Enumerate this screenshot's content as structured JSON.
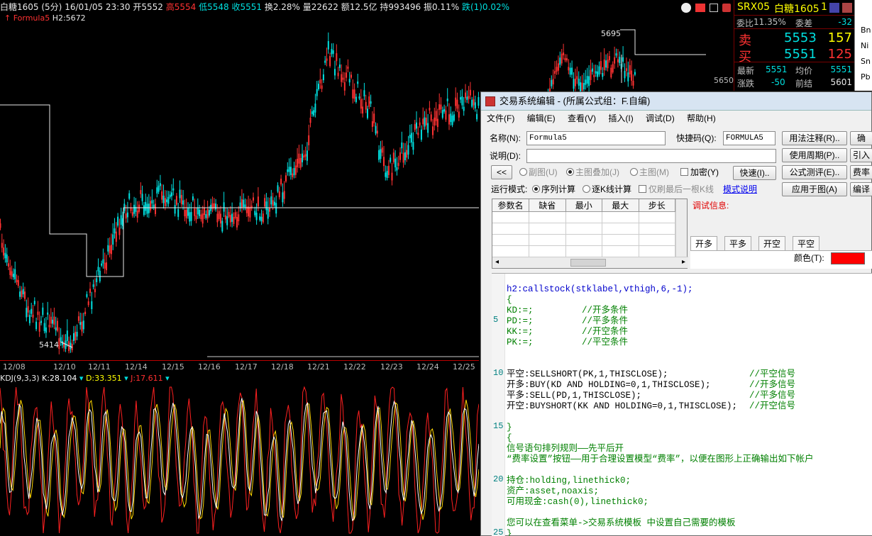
{
  "chart_header": {
    "symbol": "白糖1605 (5分)",
    "date_time": "16/01/05 23:30",
    "open": "开5552",
    "high": "高5554",
    "low": "低5548",
    "close": "收5551",
    "turnover": "换2.28%",
    "volume": "量22622",
    "amount": "额12.5亿",
    "position": "持993496",
    "amplitude": "振0.11%",
    "change": "跌(1)0.02%",
    "formula_name": "Formula5",
    "formula_value": "H2:5672"
  },
  "price_labels": {
    "high_mark": "5695",
    "low_mark": "5414",
    "scale": "5650"
  },
  "x_axis": [
    "12/08",
    "12/10",
    "12/11",
    "12/14",
    "12/15",
    "12/16",
    "12/17",
    "12/18",
    "12/21",
    "12/22",
    "12/23",
    "12/24",
    "12/25"
  ],
  "kdj_header": {
    "name": "KDJ(9,3,3)",
    "k": "K:28.104",
    "d": "D:33.351",
    "j": "J:17.611"
  },
  "quote": {
    "code": "SRX05",
    "name": "白糖1605",
    "count": "1",
    "weibi_label": "委比",
    "weibi_value": "11.35%",
    "weicha_label": "委差",
    "weicha_value": "-32",
    "sell_label": "卖",
    "sell_price": "5553",
    "sell_volume": "157",
    "buy_label": "买",
    "buy_price": "5551",
    "buy_volume": "125",
    "latest_label": "最新",
    "latest_value": "5551",
    "avg_label": "均价",
    "avg_value": "5551",
    "chg_label": "涨跌",
    "chg_value": "-50",
    "prev_label": "前结",
    "prev_value": "5601"
  },
  "side_strip": [
    "Bn",
    "Ni",
    "Sn",
    "Pb"
  ],
  "dialog": {
    "title": "交易系统编辑 - (所属公式组：F.自编)",
    "menu": [
      "文件(F)",
      "编辑(E)",
      "查看(V)",
      "插入(I)",
      "调试(D)",
      "帮助(H)"
    ],
    "name_label": "名称(N):",
    "name_value": "Formula5",
    "shortcut_label": "快捷码(Q):",
    "shortcut_value": "FORMULA5",
    "desc_label": "说明(D):",
    "desc_value": "",
    "collapse_btn": "<<",
    "radio_fushu": "副图(U)",
    "radio_zhutu_diejia": "主图叠加(J)",
    "radio_zhutu": "主图(M)",
    "check_encrypt": "加密(Y)",
    "btn_fast": "快速(I)..",
    "run_mode_label": "运行模式:",
    "run_mode_seq": "序列计算",
    "run_mode_kline": "逐K线计算",
    "check_refresh_last": "仅刷最后一根K线",
    "mode_help": "模式说明",
    "right_buttons": [
      "用法注释(R)..",
      "使用周期(P)..",
      "公式测评(E)..",
      "应用于图(A)"
    ],
    "far_buttons": [
      "确",
      "引入",
      "费率",
      "编译"
    ],
    "param_headers": [
      "参数名",
      "缺省",
      "最小",
      "最大",
      "步长"
    ],
    "debug_label": "调试信息:",
    "signal_tabs": [
      "开多",
      "平多",
      "开空",
      "平空"
    ],
    "color_label": "颜色(T):",
    "color_value": "#ff0000",
    "line_numbers": [
      "5",
      "10",
      "15",
      "20",
      "25"
    ],
    "code": {
      "l1": "h2:callstock(stklabel,vthigh,6,-1);",
      "l2": "{",
      "l3a": "KD:=;",
      "l3b": "//开多条件",
      "l4a": "PD:=;",
      "l4b": "//平多条件",
      "l5a": "KK:=;",
      "l5b": "//开空条件",
      "l6a": "PK:=;",
      "l6b": "//平空条件",
      "l7a": "平空:SELLSHORT(PK,1,THISCLOSE);",
      "l7b": "//平空信号",
      "l8a": "开多:BUY(KD AND HOLDING=0,1,THISCLOSE);",
      "l8b": "//开多信号",
      "l9a": "平多:SELL(PD,1,THISCLOSE);",
      "l9b": "//平多信号",
      "l10a": "开空:BUYSHORT(KK AND HOLDING=0,1,THISCLOSE);",
      "l10b": "//开空信号",
      "l11": "}",
      "l12": "{",
      "l13": "信号语句排列规则——先平后开",
      "l14": "“费率设置”按钮——用于合理设置模型“费率”，以便在图形上正确输出如下帐户",
      "l15": "持仓:holding,linethick0;",
      "l16": "资产:asset,noaxis;",
      "l17": "可用现金:cash(0),linethick0;",
      "l18": "您可以在查看菜单->交易系统模板 中设置自己需要的模板",
      "l19": "}"
    }
  },
  "colors": {
    "up": "#ff3232",
    "down": "#00e0e0",
    "kdj_k": "#ffffff",
    "kdj_d": "#ffd700",
    "kdj_j": "#ff2020"
  }
}
